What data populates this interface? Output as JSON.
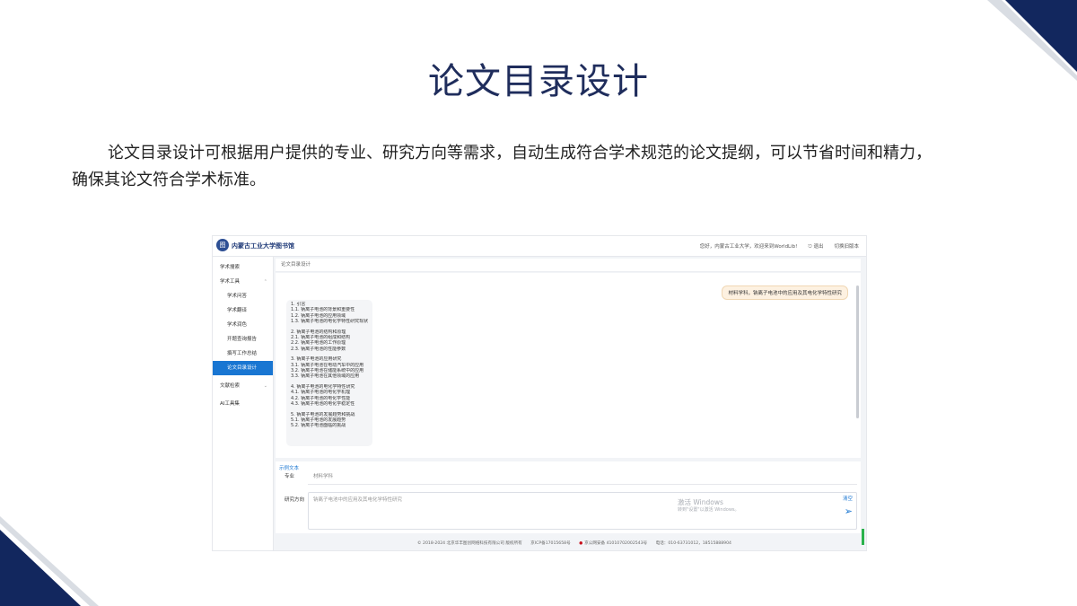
{
  "slide": {
    "title": "论文目录设计",
    "body": "论文目录设计可根据用户提供的专业、研究方向等需求，自动生成符合学术规范的论文提纲，可以节省时间和精力，确保其论文符合学术标准。",
    "colors": {
      "accent": "#1f2d5c",
      "corner_dark": "#12275e",
      "corner_light": "#d9dde3"
    }
  },
  "screenshot": {
    "header": {
      "logo_text": "内蒙古工业大学图书馆",
      "welcome": "您好，内蒙古工业大学，欢迎来到WorldLib!",
      "logout": "退出",
      "switch_version": "切换旧版本"
    },
    "sidebar": {
      "items": [
        {
          "label": "学术搜索",
          "level": 0,
          "active": false
        },
        {
          "label": "学术工具",
          "level": 0,
          "active": false,
          "chevron": "chevron-up-icon"
        },
        {
          "label": "学术问答",
          "level": 1,
          "active": false
        },
        {
          "label": "学术翻译",
          "level": 1,
          "active": false
        },
        {
          "label": "学术润色",
          "level": 1,
          "active": false
        },
        {
          "label": "开题查询报告",
          "level": 1,
          "active": false
        },
        {
          "label": "撰写工作总结",
          "level": 1,
          "active": false
        },
        {
          "label": "论文目录设计",
          "level": 1,
          "active": true
        },
        {
          "label": "文献检索",
          "level": 0,
          "active": false,
          "chevron": "chevron-down-icon"
        },
        {
          "label": "AI工具集",
          "level": 0,
          "active": false
        }
      ]
    },
    "main": {
      "panel_title": "论文目录设计",
      "user_message": "材料学科，钠离子电池中的应用及其电化学特性研究",
      "answer": [
        [
          "1. 引言",
          "1.1. 钠离子电池的背景和重要性",
          "1.2. 钠离子电池的应用领域",
          "1.3. 钠离子电池的电化学特性研究现状"
        ],
        [
          "2. 钠离子电池的结构和原理",
          "2.1. 钠离子电池的组成和结构",
          "2.2. 钠离子电池的工作原理",
          "2.3. 钠离子电池的性能参数"
        ],
        [
          "3. 钠离子电池的应用研究",
          "3.1. 钠离子电池在电动汽车中的应用",
          "3.2. 钠离子电池在储能系统中的应用",
          "3.3. 钠离子电池在其他领域的应用"
        ],
        [
          "4. 钠离子电池的电化学特性研究",
          "4.1. 钠离子电池的电化学机理",
          "4.2. 钠离子电池的电化学性能",
          "4.3. 钠离子电池的电化学稳定性"
        ],
        [
          "5. 钠离子电池的发展趋势和挑战",
          "5.1. 钠离子电池的发展趋势",
          "5.2. 钠离子电池面临的挑战"
        ]
      ]
    },
    "form": {
      "section_title": "示例文本",
      "major_label": "专业",
      "major_value": "材料学科",
      "direction_label": "研究方向",
      "direction_placeholder": "钠离子电池中的应用及其电化学特性研究",
      "clear_label": "清空"
    },
    "watermark": {
      "line1": "激活 Windows",
      "line2": "转到\"设置\"以激活 Windows。"
    },
    "footer": {
      "copyright": "© 2018-2024 北京华丰图创网络科技有限公司 版权所有",
      "icp": "京ICP备17015658号",
      "police": "京公网安备 41010702002543号",
      "phone": "电话：010-63731012，18515888904"
    }
  }
}
